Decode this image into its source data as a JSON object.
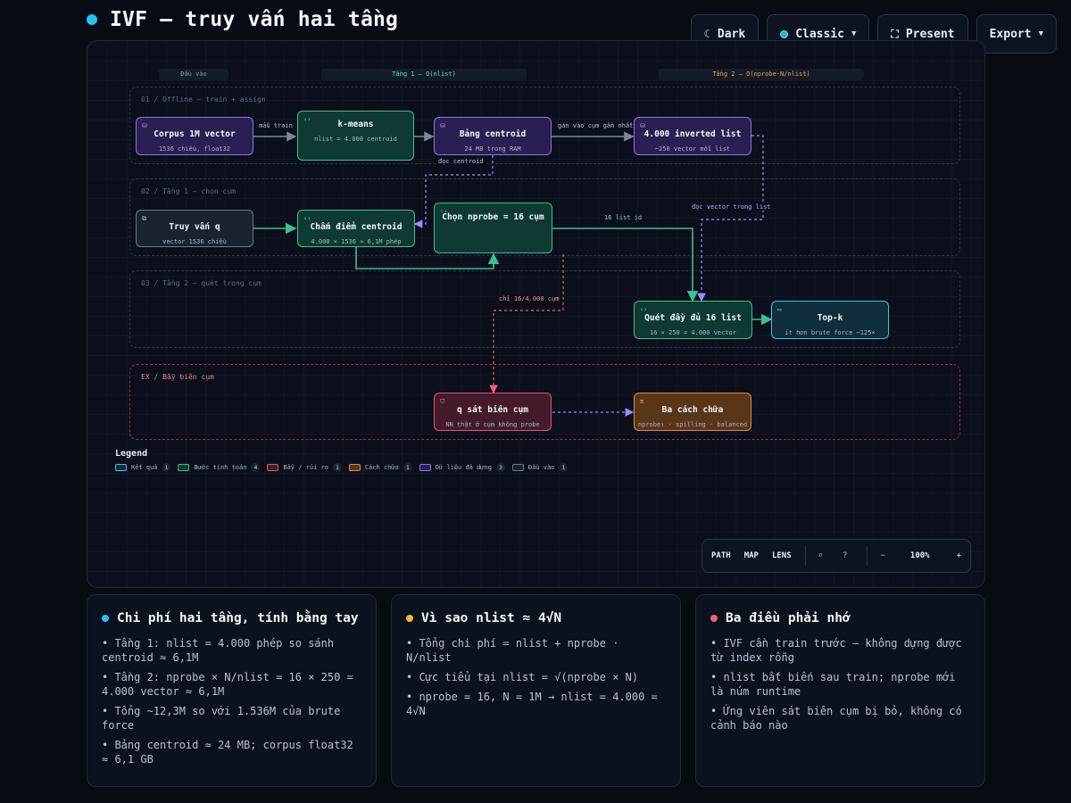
{
  "header": {
    "title": "IVF — truy vấn hai tầng",
    "title_dot_color": "#23c4ef"
  },
  "toolbar": {
    "theme_label": "Dark",
    "style_label": "Classic",
    "present_label": "Present",
    "export_label": "Export"
  },
  "diagram": {
    "columns": [
      "Đầu vào",
      "Tầng 1 — O(nlist)",
      "Tầng 2 — O(nprobe·N/nlist)"
    ],
    "lanes": {
      "offline": "01 / Offline — train + assign",
      "tier1": "02 / Tầng 1 — chọn cụm",
      "tier2": "03 / Tầng 2 — quét trong cụm",
      "trap": "EX / Bẫy biên cụm"
    },
    "nodes": {
      "corpus": {
        "title": "Corpus 1M vector",
        "sub": "1536 chiều, float32"
      },
      "kmeans": {
        "title": "k-means",
        "sub": "nlist = 4.000 centroid"
      },
      "centroids": {
        "title": "Bảng centroid",
        "sub": "24 MB trong RAM"
      },
      "inverted": {
        "title": "4.000 inverted list",
        "sub": "~250 vector mỗi list"
      },
      "query": {
        "title": "Truy vấn q",
        "sub": "vector 1536 chiều"
      },
      "score": {
        "title": "Chấm điểm centroid",
        "sub": "4.000 × 1536 ≈ 6,1M phép"
      },
      "nprobe": {
        "title": "Chọn nprobe = 16 cụm",
        "sub": ""
      },
      "scan": {
        "title": "Quét đầy đủ 16 list",
        "sub": "16 × 250 = 4.000 vector"
      },
      "topk": {
        "title": "Top-k",
        "sub": "ít hơn brute force ~125×"
      },
      "edge_q": {
        "title": "q sát biên cụm",
        "sub": "NN thật ở cụm không probe"
      },
      "fixes": {
        "title": "Ba cách chữa",
        "sub": "nprobe↑ · spilling · balanced"
      }
    },
    "edge_labels": {
      "train": "mẫu train",
      "assign": "gán vào cụm gần nhất",
      "read_centroid": "đọc centroid",
      "list_ids": "16 list id",
      "read_vectors": "đọc vector trong list",
      "only": "chỉ 16/4.000 cụm"
    },
    "legend": {
      "title": "Legend",
      "items": [
        {
          "label": "Kết quả",
          "count": "1",
          "color": "#35c6e6"
        },
        {
          "label": "Bước tính toán",
          "count": "4",
          "color": "#3bbf94"
        },
        {
          "label": "Bẫy / rủi ro",
          "count": "1",
          "color": "#e05378"
        },
        {
          "label": "Cách chữa",
          "count": "1",
          "color": "#e08a3d"
        },
        {
          "label": "Dữ liệu đã dựng",
          "count": "3",
          "color": "#8e73e6"
        },
        {
          "label": "Đầu vào",
          "count": "1",
          "color": "#6c778a"
        }
      ]
    },
    "viewbar": {
      "path": "PATH",
      "map": "MAP",
      "lens": "LENS",
      "zoom": "100%",
      "minus": "−",
      "plus": "+"
    }
  },
  "cards": [
    {
      "title": "Chi phí hai tầng, tính bằng tay",
      "dot_color": "#23c4ef",
      "items": [
        "• Tầng 1: nlist = 4.000 phép so sánh centroid ≈ 6,1M",
        "• Tầng 2: nprobe × N/nlist = 16 × 250 = 4.000 vector ≈ 6,1M",
        "• Tổng ~12,3M so với 1.536M của brute force",
        "• Bảng centroid ≈ 24 MB; corpus float32 ≈ 6,1 GB"
      ]
    },
    {
      "title": "Vì sao nlist ≈ 4√N",
      "dot_color": "#f5b82e",
      "items": [
        "• Tổng chi phí = nlist + nprobe · N/nlist",
        "• Cực tiểu tại nlist = √(nprobe × N)",
        "• nprobe = 16, N = 1M → nlist = 4.000 = 4√N"
      ]
    },
    {
      "title": "Ba điều phải nhớ",
      "dot_color": "#f0607c",
      "items": [
        "• IVF cần train trước — không dựng được từ index rỗng",
        "• nlist bất biến sau train; nprobe mới là núm runtime",
        "• Ứng viên sát biên cụm bị bỏ, không có cảnh báo nào"
      ]
    }
  ]
}
